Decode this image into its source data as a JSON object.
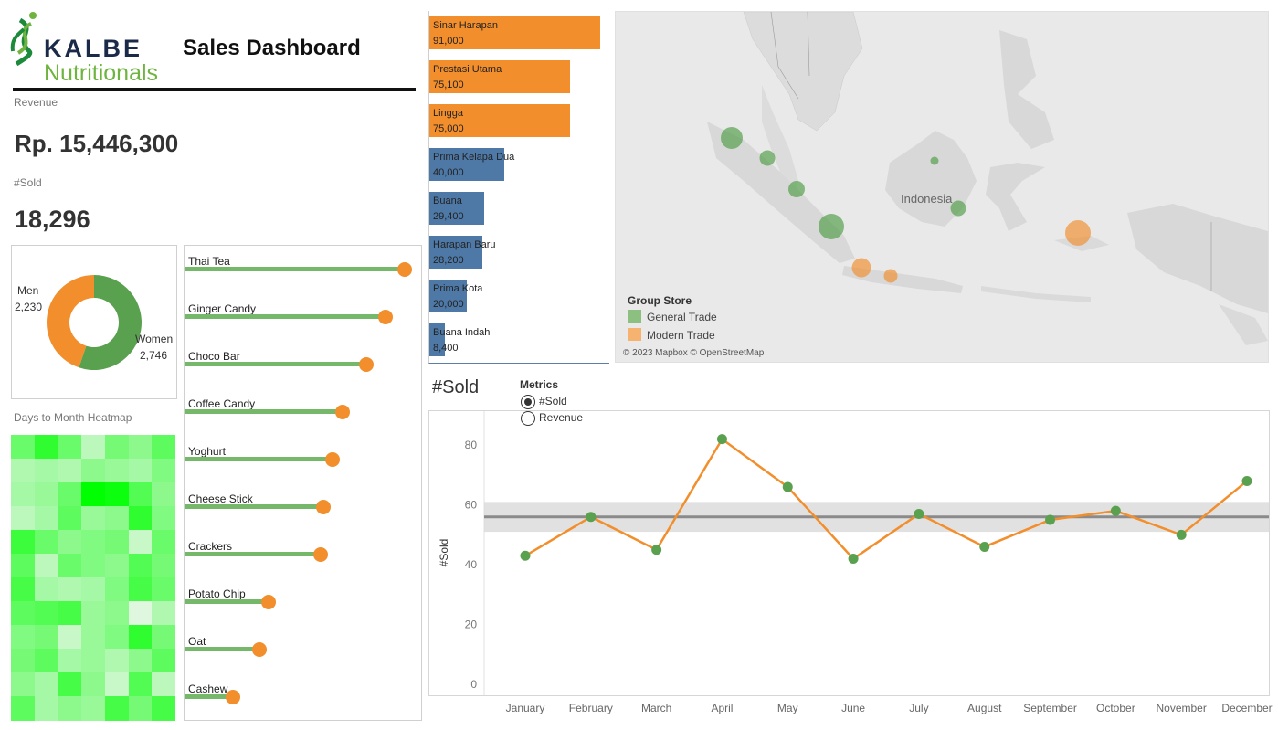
{
  "header": {
    "brand": "KALBE",
    "brand_sub": "Nutritionals",
    "title": "Sales Dashboard"
  },
  "kpis": {
    "revenue_label": "Revenue",
    "revenue_value": "Rp. 15,446,300",
    "sold_label": "#Sold",
    "sold_value": "18,296"
  },
  "gender": {
    "men_label": "Men",
    "men_value": "2,230",
    "men_num": 2230,
    "women_label": "Women",
    "women_value": "2,746",
    "women_num": 2746,
    "men_color": "#f28e2b",
    "women_color": "#59a14f"
  },
  "heatmap": {
    "title": "Days to Month Heatmap",
    "intensity": [
      [
        0.55,
        0.8,
        0.55,
        0.2,
        0.5,
        0.4,
        0.6
      ],
      [
        0.25,
        0.3,
        0.25,
        0.4,
        0.35,
        0.3,
        0.45
      ],
      [
        0.3,
        0.35,
        0.55,
        1.0,
        0.95,
        0.65,
        0.4
      ],
      [
        0.2,
        0.3,
        0.6,
        0.35,
        0.4,
        0.8,
        0.45
      ],
      [
        0.75,
        0.55,
        0.4,
        0.45,
        0.5,
        0.15,
        0.55
      ],
      [
        0.6,
        0.2,
        0.55,
        0.45,
        0.4,
        0.65,
        0.5
      ],
      [
        0.7,
        0.3,
        0.25,
        0.3,
        0.45,
        0.7,
        0.55
      ],
      [
        0.6,
        0.65,
        0.7,
        0.35,
        0.4,
        0.05,
        0.25
      ],
      [
        0.45,
        0.5,
        0.15,
        0.35,
        0.45,
        0.8,
        0.5
      ],
      [
        0.5,
        0.6,
        0.3,
        0.35,
        0.25,
        0.4,
        0.6
      ],
      [
        0.4,
        0.3,
        0.7,
        0.4,
        0.15,
        0.65,
        0.2
      ],
      [
        0.6,
        0.3,
        0.4,
        0.35,
        0.7,
        0.5,
        0.7
      ]
    ]
  },
  "products": {
    "names": [
      "Thai Tea",
      "Ginger Candy",
      "Choco Bar",
      "Coffee Candy",
      "Yoghurt",
      "Cheese Stick",
      "Crackers",
      "Potato Chip",
      "Oat",
      "Cashew"
    ],
    "values": [
      92,
      84,
      76,
      66,
      62,
      58,
      57,
      35,
      31,
      20
    ],
    "stem_color": "#76b86a",
    "dot_color": "#f28e2b"
  },
  "stores": [
    {
      "name": "Sinar Harapan",
      "value": "91,000",
      "num": 91000,
      "group": "Modern Trade"
    },
    {
      "name": "Prestasi Utama",
      "value": "75,100",
      "num": 75100,
      "group": "Modern Trade"
    },
    {
      "name": "Lingga",
      "value": "75,000",
      "num": 75000,
      "group": "Modern Trade"
    },
    {
      "name": "Prima Kelapa Dua",
      "value": "40,000",
      "num": 40000,
      "group": "General Trade"
    },
    {
      "name": "Buana",
      "value": "29,400",
      "num": 29400,
      "group": "General Trade"
    },
    {
      "name": "Harapan Baru",
      "value": "28,200",
      "num": 28200,
      "group": "General Trade"
    },
    {
      "name": "Prima Kota",
      "value": "20,000",
      "num": 20000,
      "group": "General Trade"
    },
    {
      "name": "Buana Indah",
      "value": "8,400",
      "num": 8400,
      "group": "General Trade"
    }
  ],
  "store_colors": {
    "Modern Trade": "#f28e2b",
    "General Trade": "#4e79a7"
  },
  "map": {
    "country_label": "Indonesia",
    "legend_title": "Group Store",
    "legend_items": [
      {
        "label": "General Trade",
        "color": "#59a14f"
      },
      {
        "label": "Modern Trade",
        "color": "#f28e2b"
      }
    ],
    "attribution": "© 2023 Mapbox © OpenStreetMap"
  },
  "line_chart": {
    "title": "#Sold",
    "metrics_label": "Metrics",
    "options": [
      {
        "label": "#Sold",
        "selected": true
      },
      {
        "label": "Revenue",
        "selected": false
      }
    ]
  },
  "chart_data": {
    "type": "line",
    "title": "#Sold",
    "xlabel": "",
    "ylabel": "#Sold",
    "categories": [
      "January",
      "February",
      "March",
      "April",
      "May",
      "June",
      "July",
      "August",
      "September",
      "October",
      "November",
      "December"
    ],
    "series": [
      {
        "values": [
          43,
          56,
          45,
          82,
          66,
          42,
          57,
          46,
          55,
          58,
          50,
          68
        ],
        "line_color": "#f28e2b",
        "marker_color": "#59a14f"
      }
    ],
    "yticks": [
      0,
      20,
      40,
      60,
      80
    ],
    "ylim": [
      0,
      88
    ],
    "reference_line": 56,
    "reference_band": [
      51,
      61
    ],
    "grid": false
  }
}
